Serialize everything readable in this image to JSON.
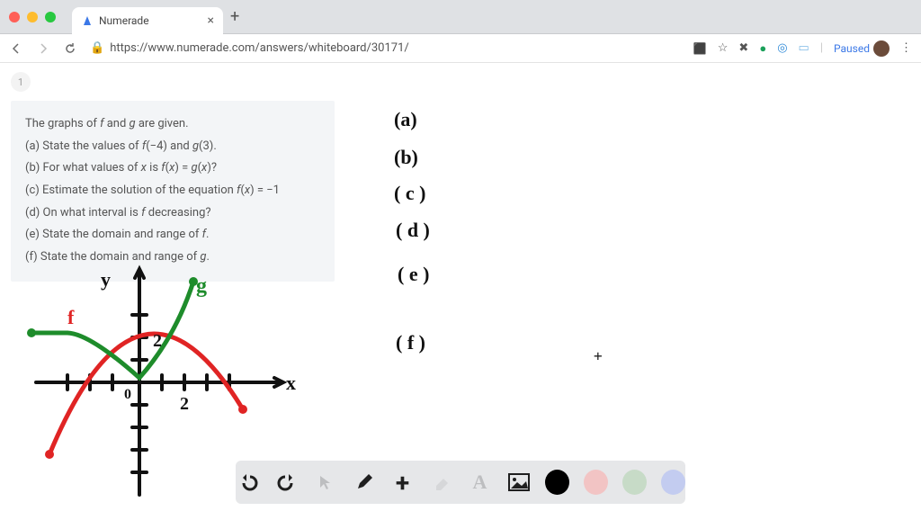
{
  "browser": {
    "tab_title": "Numerade",
    "url": "https://www.numerade.com/answers/whiteboard/30171/",
    "paused_label": "Paused"
  },
  "page_number": "1",
  "question": {
    "intro": "The graphs of f and g are given.",
    "a": "(a) State the values of f(−4) and g(3).",
    "b": "(b) For what values of x is f(x) = g(x)?",
    "c": "(c) Estimate the solution of the equation f(x) = −1",
    "d": "(d) On what interval is f decreasing?",
    "e": "(e) State the domain and range of f.",
    "f": "(f) State the domain and range of g."
  },
  "handwritten": {
    "a": "(a)",
    "b": "(b)",
    "c": "( c )",
    "d": "( d )",
    "e": "( e )",
    "f": "( f )"
  },
  "graph": {
    "axis_x_label": "x",
    "axis_y_label": "y",
    "f_label": "f",
    "g_label": "g",
    "tick_label_x": "2",
    "tick_label_y": "2"
  },
  "toolbar": {
    "colors": {
      "black": "#000000",
      "pink": "#f2c4c4",
      "green": "#c7dbc7",
      "blue": "#c3ccf0"
    }
  }
}
